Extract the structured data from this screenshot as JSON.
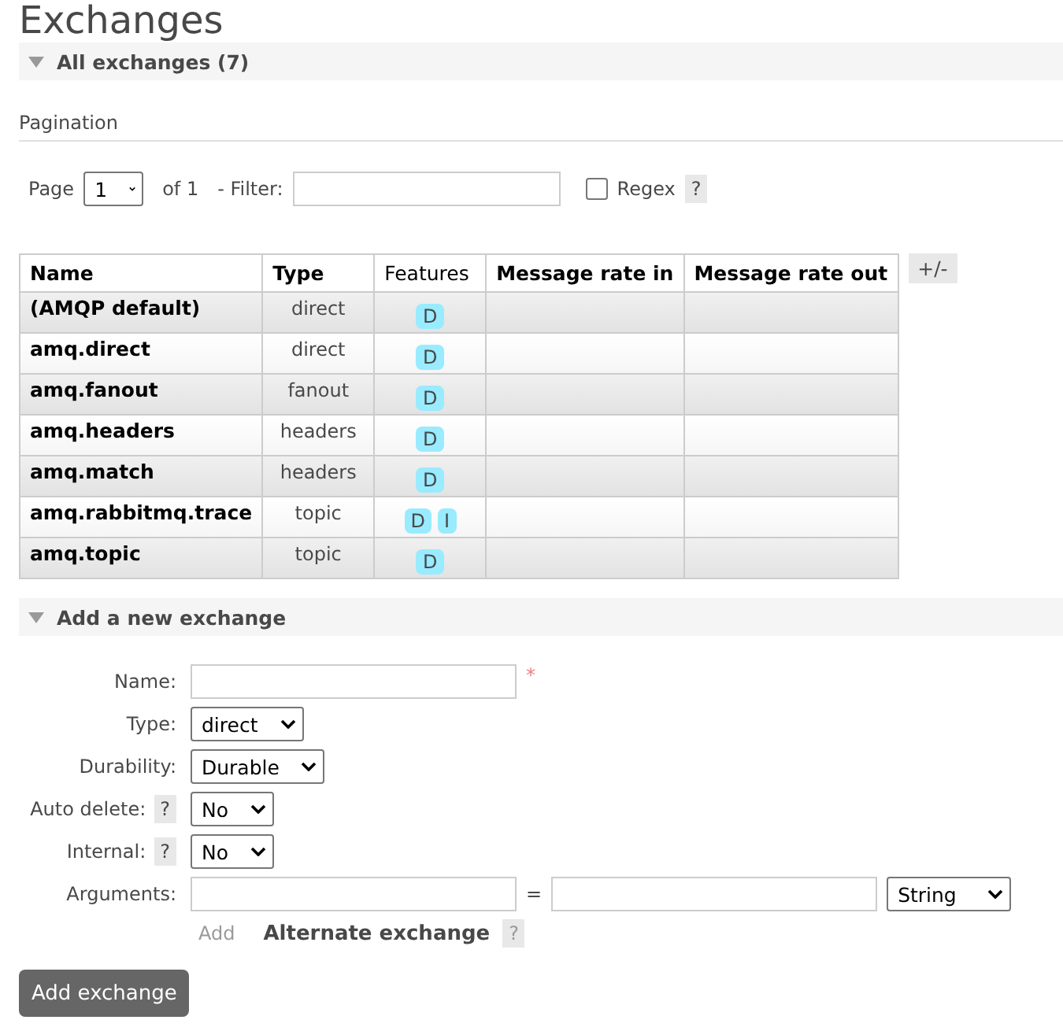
{
  "title": "Exchanges",
  "all_section": {
    "header": "All exchanges (7)",
    "expanded": true
  },
  "pagination": {
    "label": "Pagination",
    "page_label": "Page",
    "page_value": "1",
    "of_text": "of 1",
    "filter_label": "- Filter:",
    "regex_label": "Regex",
    "regex_checked": false,
    "help": "?"
  },
  "table": {
    "columns": [
      {
        "label": "Name",
        "bold": true
      },
      {
        "label": "Type",
        "bold": true
      },
      {
        "label": "Features",
        "bold": false
      },
      {
        "label": "Message rate in",
        "bold": true
      },
      {
        "label": "Message rate out",
        "bold": true
      }
    ],
    "toggle_columns": "+/-",
    "rows": [
      {
        "name": "(AMQP default)",
        "type": "direct",
        "features": [
          "D"
        ]
      },
      {
        "name": "amq.direct",
        "type": "direct",
        "features": [
          "D"
        ]
      },
      {
        "name": "amq.fanout",
        "type": "fanout",
        "features": [
          "D"
        ]
      },
      {
        "name": "amq.headers",
        "type": "headers",
        "features": [
          "D"
        ]
      },
      {
        "name": "amq.match",
        "type": "headers",
        "features": [
          "D"
        ]
      },
      {
        "name": "amq.rabbitmq.trace",
        "type": "topic",
        "features": [
          "D",
          "I"
        ]
      },
      {
        "name": "amq.topic",
        "type": "topic",
        "features": [
          "D"
        ]
      }
    ]
  },
  "add_section": {
    "header": "Add a new exchange",
    "expanded": true,
    "fields": [
      {
        "kind": "text",
        "label": "Name:",
        "required_mark": "*"
      },
      {
        "kind": "select",
        "label": "Type:",
        "value": "direct"
      },
      {
        "kind": "select",
        "label": "Durability:",
        "value": "Durable"
      },
      {
        "kind": "select",
        "label": "Auto delete:",
        "help": "?",
        "value": "No"
      },
      {
        "kind": "select",
        "label": "Internal:",
        "help": "?",
        "value": "No"
      },
      {
        "kind": "arguments",
        "label": "Arguments:",
        "equals": "=",
        "type_value": "String"
      }
    ],
    "add_link": "Add",
    "alternate_link": "Alternate exchange",
    "alternate_help": "?",
    "submit": "Add exchange"
  }
}
